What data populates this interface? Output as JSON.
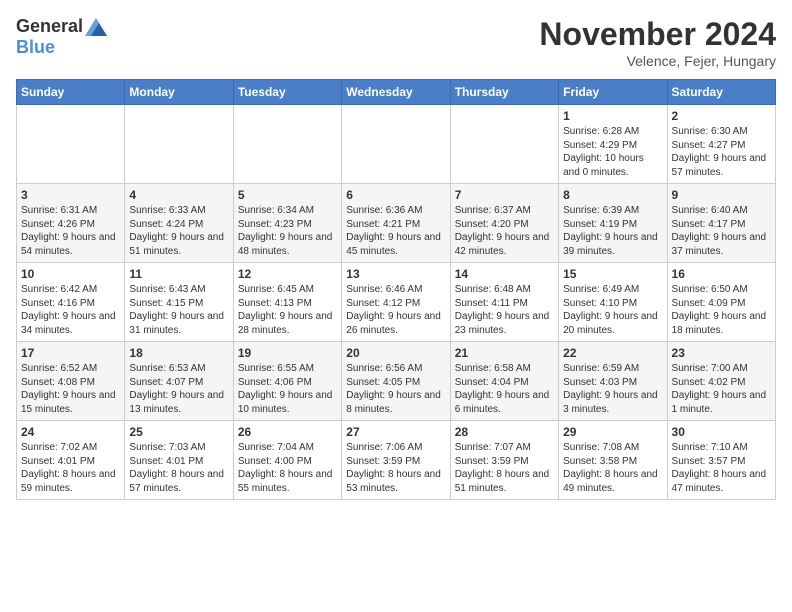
{
  "header": {
    "logo_general": "General",
    "logo_blue": "Blue",
    "month_title": "November 2024",
    "location": "Velence, Fejer, Hungary"
  },
  "days_of_week": [
    "Sunday",
    "Monday",
    "Tuesday",
    "Wednesday",
    "Thursday",
    "Friday",
    "Saturday"
  ],
  "weeks": [
    [
      {
        "day": "",
        "info": ""
      },
      {
        "day": "",
        "info": ""
      },
      {
        "day": "",
        "info": ""
      },
      {
        "day": "",
        "info": ""
      },
      {
        "day": "",
        "info": ""
      },
      {
        "day": "1",
        "info": "Sunrise: 6:28 AM\nSunset: 4:29 PM\nDaylight: 10 hours and 0 minutes."
      },
      {
        "day": "2",
        "info": "Sunrise: 6:30 AM\nSunset: 4:27 PM\nDaylight: 9 hours and 57 minutes."
      }
    ],
    [
      {
        "day": "3",
        "info": "Sunrise: 6:31 AM\nSunset: 4:26 PM\nDaylight: 9 hours and 54 minutes."
      },
      {
        "day": "4",
        "info": "Sunrise: 6:33 AM\nSunset: 4:24 PM\nDaylight: 9 hours and 51 minutes."
      },
      {
        "day": "5",
        "info": "Sunrise: 6:34 AM\nSunset: 4:23 PM\nDaylight: 9 hours and 48 minutes."
      },
      {
        "day": "6",
        "info": "Sunrise: 6:36 AM\nSunset: 4:21 PM\nDaylight: 9 hours and 45 minutes."
      },
      {
        "day": "7",
        "info": "Sunrise: 6:37 AM\nSunset: 4:20 PM\nDaylight: 9 hours and 42 minutes."
      },
      {
        "day": "8",
        "info": "Sunrise: 6:39 AM\nSunset: 4:19 PM\nDaylight: 9 hours and 39 minutes."
      },
      {
        "day": "9",
        "info": "Sunrise: 6:40 AM\nSunset: 4:17 PM\nDaylight: 9 hours and 37 minutes."
      }
    ],
    [
      {
        "day": "10",
        "info": "Sunrise: 6:42 AM\nSunset: 4:16 PM\nDaylight: 9 hours and 34 minutes."
      },
      {
        "day": "11",
        "info": "Sunrise: 6:43 AM\nSunset: 4:15 PM\nDaylight: 9 hours and 31 minutes."
      },
      {
        "day": "12",
        "info": "Sunrise: 6:45 AM\nSunset: 4:13 PM\nDaylight: 9 hours and 28 minutes."
      },
      {
        "day": "13",
        "info": "Sunrise: 6:46 AM\nSunset: 4:12 PM\nDaylight: 9 hours and 26 minutes."
      },
      {
        "day": "14",
        "info": "Sunrise: 6:48 AM\nSunset: 4:11 PM\nDaylight: 9 hours and 23 minutes."
      },
      {
        "day": "15",
        "info": "Sunrise: 6:49 AM\nSunset: 4:10 PM\nDaylight: 9 hours and 20 minutes."
      },
      {
        "day": "16",
        "info": "Sunrise: 6:50 AM\nSunset: 4:09 PM\nDaylight: 9 hours and 18 minutes."
      }
    ],
    [
      {
        "day": "17",
        "info": "Sunrise: 6:52 AM\nSunset: 4:08 PM\nDaylight: 9 hours and 15 minutes."
      },
      {
        "day": "18",
        "info": "Sunrise: 6:53 AM\nSunset: 4:07 PM\nDaylight: 9 hours and 13 minutes."
      },
      {
        "day": "19",
        "info": "Sunrise: 6:55 AM\nSunset: 4:06 PM\nDaylight: 9 hours and 10 minutes."
      },
      {
        "day": "20",
        "info": "Sunrise: 6:56 AM\nSunset: 4:05 PM\nDaylight: 9 hours and 8 minutes."
      },
      {
        "day": "21",
        "info": "Sunrise: 6:58 AM\nSunset: 4:04 PM\nDaylight: 9 hours and 6 minutes."
      },
      {
        "day": "22",
        "info": "Sunrise: 6:59 AM\nSunset: 4:03 PM\nDaylight: 9 hours and 3 minutes."
      },
      {
        "day": "23",
        "info": "Sunrise: 7:00 AM\nSunset: 4:02 PM\nDaylight: 9 hours and 1 minute."
      }
    ],
    [
      {
        "day": "24",
        "info": "Sunrise: 7:02 AM\nSunset: 4:01 PM\nDaylight: 8 hours and 59 minutes."
      },
      {
        "day": "25",
        "info": "Sunrise: 7:03 AM\nSunset: 4:01 PM\nDaylight: 8 hours and 57 minutes."
      },
      {
        "day": "26",
        "info": "Sunrise: 7:04 AM\nSunset: 4:00 PM\nDaylight: 8 hours and 55 minutes."
      },
      {
        "day": "27",
        "info": "Sunrise: 7:06 AM\nSunset: 3:59 PM\nDaylight: 8 hours and 53 minutes."
      },
      {
        "day": "28",
        "info": "Sunrise: 7:07 AM\nSunset: 3:59 PM\nDaylight: 8 hours and 51 minutes."
      },
      {
        "day": "29",
        "info": "Sunrise: 7:08 AM\nSunset: 3:58 PM\nDaylight: 8 hours and 49 minutes."
      },
      {
        "day": "30",
        "info": "Sunrise: 7:10 AM\nSunset: 3:57 PM\nDaylight: 8 hours and 47 minutes."
      }
    ]
  ]
}
